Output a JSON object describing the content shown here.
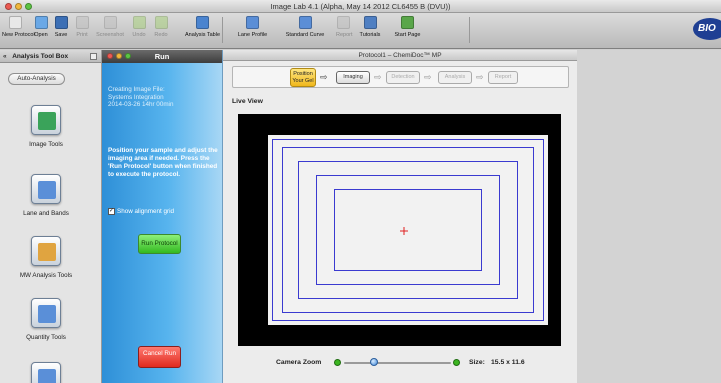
{
  "app": {
    "title": "Image Lab 4.1 (Alpha, May 14 2012 CL6455 B (DVU))",
    "brand": "BIO"
  },
  "toolbar": {
    "items": [
      {
        "label": "New Protocol",
        "icon": "new-protocol-icon",
        "color": "#e8e8e8",
        "enabled": true
      },
      {
        "label": "Open",
        "icon": "folder-icon",
        "color": "#6aa8e6",
        "enabled": true
      },
      {
        "label": "Save",
        "icon": "floppy-icon",
        "color": "#3c6fb5",
        "enabled": true
      },
      {
        "label": "Print",
        "icon": "printer-icon",
        "color": "#bbbbbb",
        "enabled": false
      },
      {
        "label": "Screenshot",
        "icon": "screenshot-icon",
        "color": "#bbbbbb",
        "enabled": false
      },
      {
        "label": "Undo",
        "icon": "undo-icon",
        "color": "#9fcf6a",
        "enabled": false
      },
      {
        "label": "Redo",
        "icon": "redo-icon",
        "color": "#9fcf6a",
        "enabled": false
      },
      {
        "label": "Analysis Table",
        "icon": "table-icon",
        "color": "#4b84cf",
        "enabled": true
      },
      {
        "label": "Lane Profile",
        "icon": "lane-profile-icon",
        "color": "#5b8ed6",
        "enabled": true
      },
      {
        "label": "Standard Curve",
        "icon": "standard-curve-icon",
        "color": "#5b8ed6",
        "enabled": true
      },
      {
        "label": "Report",
        "icon": "report-icon",
        "color": "#bbbbbb",
        "enabled": false
      },
      {
        "label": "Tutorials",
        "icon": "tutorials-icon",
        "color": "#4f7fc2",
        "enabled": true
      },
      {
        "label": "Start Page",
        "icon": "start-page-icon",
        "color": "#5aa64a",
        "enabled": true
      }
    ]
  },
  "toolbox": {
    "title": "Analysis Tool Box",
    "auto_analysis": "Auto-Analysis",
    "tools": [
      {
        "label": "Image Tools",
        "icon": "image-tools-icon",
        "color": "#3aa35a"
      },
      {
        "label": "Lane and Bands",
        "icon": "lane-bands-icon",
        "color": "#5a8fd8"
      },
      {
        "label": "MW Analysis Tools",
        "icon": "mw-analysis-icon",
        "color": "#e0a440"
      },
      {
        "label": "Quantity Tools",
        "icon": "quantity-tools-icon",
        "color": "#5a8fd8"
      }
    ]
  },
  "run_panel": {
    "title": "Run",
    "creating_text": "Creating Image File:\nSystems Integration\n2014-03-26 14hr 00min",
    "instructions": "Position your sample and adjust the imaging area if needed. Press the 'Run Protocol' button when finished to execute the protocol.",
    "show_grid_label": "Show alignment grid",
    "show_grid_checked": true,
    "run_button": "Run Protocol",
    "cancel_button": "Cancel Run"
  },
  "protocol_window": {
    "title": "Protocol1 – ChemiDoc™ MP",
    "steps": [
      {
        "label": "Position Your Gel",
        "state": "active"
      },
      {
        "label": "Imaging",
        "state": "next"
      },
      {
        "label": "Detection",
        "state": "disabled"
      },
      {
        "label": "Analysis",
        "state": "disabled"
      },
      {
        "label": "Report",
        "state": "disabled"
      }
    ],
    "live_view_label": "Live View",
    "camera_zoom_label": "Camera Zoom",
    "camera_zoom_level": 0.28,
    "size_label": "Size:",
    "size_value": "15.5 x 11.6"
  },
  "colors": {
    "grid_line": "#3a3ad0",
    "crosshair": "#e02020",
    "run_panel": "#3b9ee2"
  }
}
